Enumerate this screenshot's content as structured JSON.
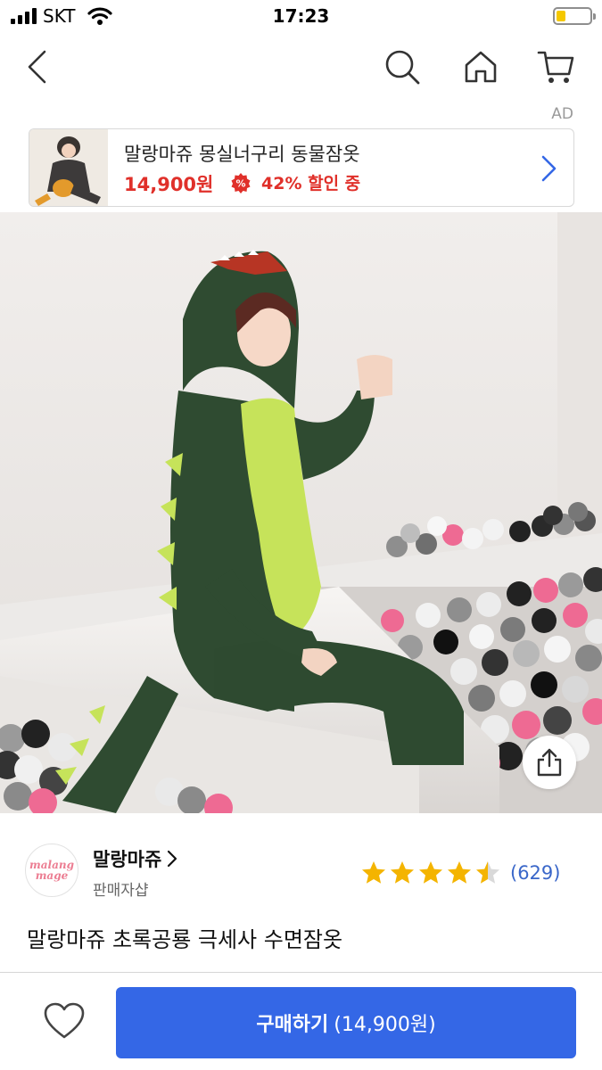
{
  "status_bar": {
    "carrier": "SKT",
    "time": "17:23"
  },
  "nav": {
    "back_icon": "chevron-left-icon",
    "search_icon": "search-icon",
    "home_icon": "home-icon",
    "cart_icon": "cart-icon"
  },
  "ad": {
    "label": "AD",
    "title": "말랑마쥬 몽실너구리 동물잠옷",
    "price": "14,900원",
    "discount": "42% 할인 중",
    "accent_color": "#e0302a"
  },
  "product_image": {
    "dots_total": 2,
    "active_dot": 1
  },
  "seller": {
    "logo_text_1": "malang",
    "logo_text_2": "mage",
    "name": "말랑마쥬",
    "subtitle": "판매자샵"
  },
  "rating": {
    "stars": 4.5,
    "max": 5,
    "count": "(629)",
    "star_color": "#f4b400"
  },
  "product": {
    "title": "말랑마쥬 초록공룡 극세사 수면잠옷"
  },
  "bottom": {
    "buy_label": "구매하기",
    "buy_price": "(14,900원)",
    "buy_color": "#3467e6"
  }
}
